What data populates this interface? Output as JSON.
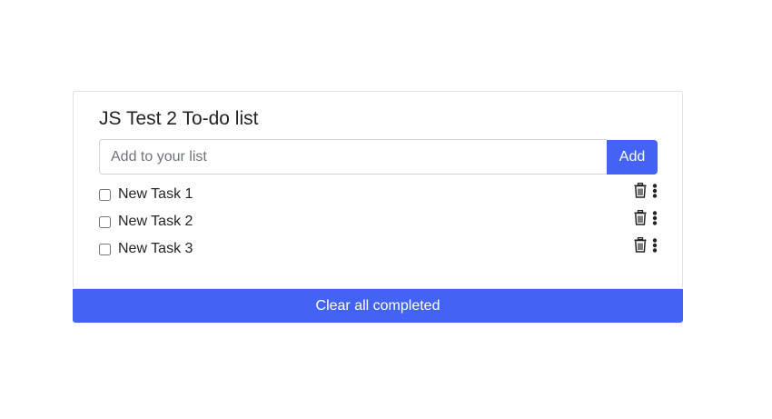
{
  "todo": {
    "title": "JS Test 2 To-do list",
    "input": {
      "value": "",
      "placeholder": "Add to your list"
    },
    "add_label": "Add",
    "tasks": [
      {
        "label": "New Task 1",
        "checked": false
      },
      {
        "label": "New Task 2",
        "checked": false
      },
      {
        "label": "New Task 3",
        "checked": false
      }
    ],
    "task_icons": [
      "trash-icon",
      "more-vertical-icon"
    ],
    "clear_label": "Clear all completed"
  },
  "colors": {
    "accent": "#4263f5",
    "border": "#dee2e6",
    "text": "#212529"
  }
}
